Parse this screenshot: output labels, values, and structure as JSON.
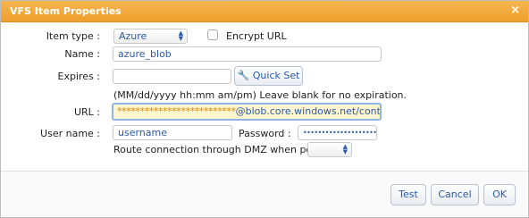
{
  "window": {
    "title": "VFS Item Properties",
    "close": "×"
  },
  "form": {
    "item_type_label": "Item type :",
    "item_type_value": "Azure",
    "encrypt_url_label": "Encrypt URL",
    "name_label": "Name :",
    "name_value": "azure_blob",
    "expires_label": "Expires :",
    "expires_value": "",
    "quick_set_label": "Quick Set",
    "expires_hint": "(MM/dd/yyyy hh:mm am/pm) Leave blank for no expiration.",
    "url_label": "URL :",
    "url_masked": "**************************",
    "url_suffix": "@blob.core.windows.net/container/",
    "username_label": "User name :",
    "username_value": "username",
    "password_label": "Password :",
    "password_value": "••••••••••••••••••••••••",
    "route_label": "Route connection through DMZ when possible :",
    "route_value": ""
  },
  "buttons": {
    "test": "Test",
    "cancel": "Cancel",
    "ok": "OK"
  },
  "icons": {
    "close": "close-icon",
    "quick_set": "wrench-icon",
    "select": "chevron-updown-icon"
  },
  "colors": {
    "titlebar": "#f2a93b",
    "link_text": "#2a5aa8",
    "url_highlight": "#fff6d0"
  }
}
